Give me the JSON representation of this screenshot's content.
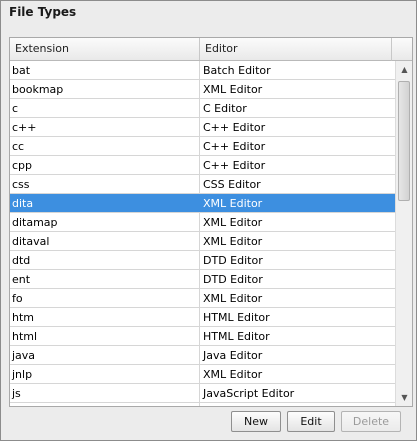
{
  "panel": {
    "title": "File Types"
  },
  "table": {
    "columns": [
      "Extension",
      "Editor"
    ],
    "rows": [
      {
        "ext": "bat",
        "editor": "Batch Editor",
        "selected": false
      },
      {
        "ext": "bookmap",
        "editor": "XML Editor",
        "selected": false
      },
      {
        "ext": "c",
        "editor": "C Editor",
        "selected": false
      },
      {
        "ext": "c++",
        "editor": "C++ Editor",
        "selected": false
      },
      {
        "ext": "cc",
        "editor": "C++ Editor",
        "selected": false
      },
      {
        "ext": "cpp",
        "editor": "C++ Editor",
        "selected": false
      },
      {
        "ext": "css",
        "editor": "CSS Editor",
        "selected": false
      },
      {
        "ext": "dita",
        "editor": "XML Editor",
        "selected": true
      },
      {
        "ext": "ditamap",
        "editor": "XML Editor",
        "selected": false
      },
      {
        "ext": "ditaval",
        "editor": "XML Editor",
        "selected": false
      },
      {
        "ext": "dtd",
        "editor": "DTD Editor",
        "selected": false
      },
      {
        "ext": "ent",
        "editor": "DTD Editor",
        "selected": false
      },
      {
        "ext": "fo",
        "editor": "XML Editor",
        "selected": false
      },
      {
        "ext": "htm",
        "editor": "HTML Editor",
        "selected": false
      },
      {
        "ext": "html",
        "editor": "HTML Editor",
        "selected": false
      },
      {
        "ext": "java",
        "editor": "Java Editor",
        "selected": false
      },
      {
        "ext": "jnlp",
        "editor": "XML Editor",
        "selected": false
      },
      {
        "ext": "js",
        "editor": "JavaScript Editor",
        "selected": false
      },
      {
        "ext": "",
        "editor": "",
        "selected": false
      }
    ],
    "scrollbar": {
      "up_icon": "arrow-up-icon",
      "down_icon": "arrow-down-icon"
    }
  },
  "buttons": {
    "new_label": "New",
    "edit_label": "Edit",
    "delete_label": "Delete",
    "delete_enabled": false
  },
  "colors": {
    "selection": "#3d8fe0",
    "background": "#ececec"
  }
}
